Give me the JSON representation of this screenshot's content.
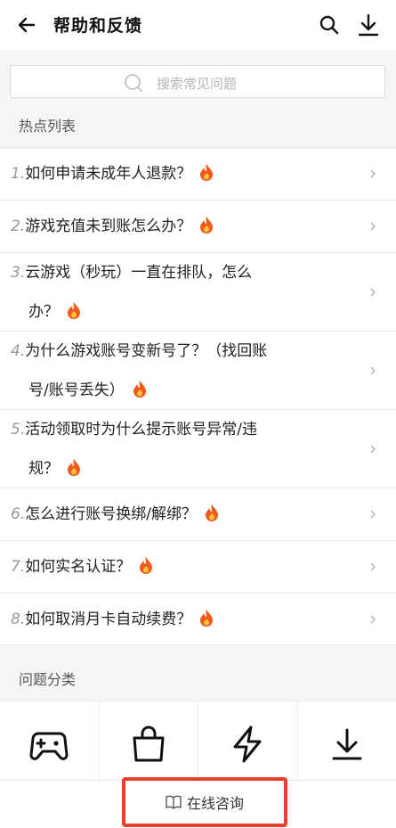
{
  "header": {
    "title": "帮助和反馈",
    "icons": [
      "back-arrow-icon",
      "search-icon",
      "download-icon"
    ]
  },
  "search": {
    "placeholder": "搜索常见问题"
  },
  "sections": {
    "hot_title": "热点列表",
    "category_title": "问题分类"
  },
  "hot_list": [
    {
      "num": "1.",
      "lines": [
        "如何申请未成年人退款？"
      ]
    },
    {
      "num": "2.",
      "lines": [
        "游戏充值未到账怎么办？"
      ]
    },
    {
      "num": "3.",
      "lines": [
        "云游戏（秒玩）一直在排队，怎么",
        "办？"
      ]
    },
    {
      "num": "4.",
      "lines": [
        "为什么游戏账号变新号了？（找回账",
        "号/账号丢失）"
      ]
    },
    {
      "num": "5.",
      "lines": [
        "活动领取时为什么提示账号异常/违",
        "规？"
      ]
    },
    {
      "num": "6.",
      "lines": [
        "怎么进行账号换绑/解绑？"
      ]
    },
    {
      "num": "7.",
      "lines": [
        "如何实名认证？"
      ]
    },
    {
      "num": "8.",
      "lines": [
        "如何取消月卡自动续费？"
      ]
    }
  ],
  "categories": [
    {
      "icon": "gamepad-icon"
    },
    {
      "icon": "shopping-bag-icon"
    },
    {
      "icon": "lightning-icon"
    },
    {
      "icon": "download-icon"
    }
  ],
  "bottom": {
    "consult_label": "在线咨询",
    "highlight_color": "#e8402d"
  }
}
